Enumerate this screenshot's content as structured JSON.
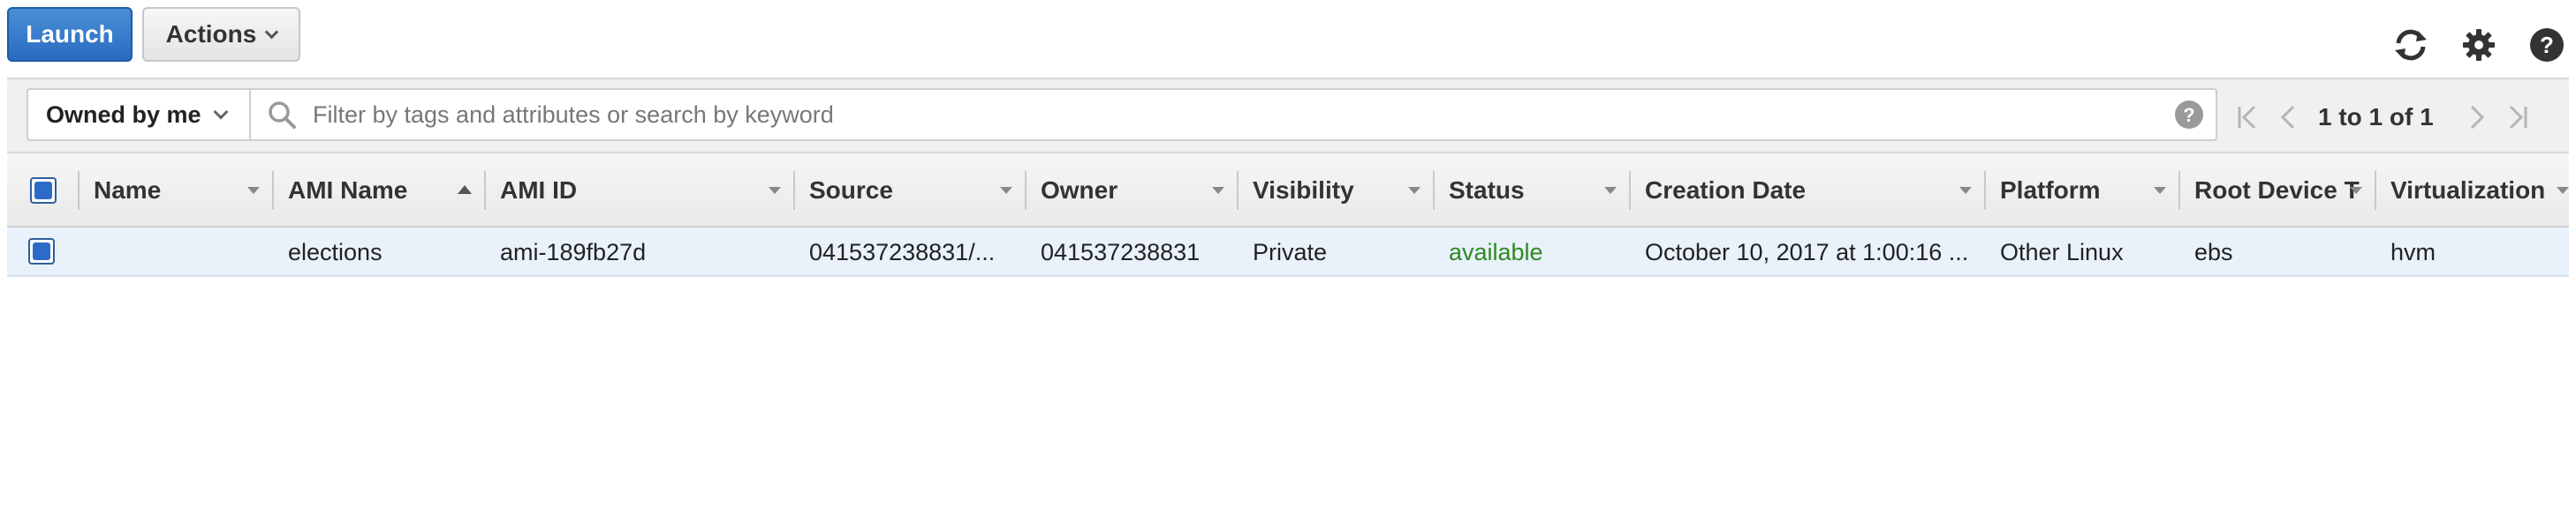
{
  "toolbar": {
    "launch_label": "Launch",
    "actions_label": "Actions"
  },
  "top_icons": [
    "refresh-icon",
    "gear-icon",
    "help-icon"
  ],
  "filter": {
    "owner_filter": "Owned by me",
    "search_placeholder": "Filter by tags and attributes or search by keyword",
    "search_value": ""
  },
  "pagination": {
    "text": "1 to 1 of 1"
  },
  "table": {
    "columns": [
      "Name",
      "AMI Name",
      "AMI ID",
      "Source",
      "Owner",
      "Visibility",
      "Status",
      "Creation Date",
      "Platform",
      "Root Device T",
      "Virtualization"
    ],
    "sorted_column": "AMI Name",
    "rows": [
      {
        "name": "",
        "ami_name": "elections",
        "ami_id": "ami-189fb27d",
        "source": "041537238831/...",
        "owner": "041537238831",
        "visibility": "Private",
        "status": "available",
        "creation_date": "October 10, 2017 at 1:00:16 ...",
        "platform": "Other Linux",
        "root_device": "ebs",
        "virtualization": "hvm",
        "selected": true
      }
    ]
  },
  "colors": {
    "primary": "#2d6bc8",
    "status_available": "#2c8a1f",
    "row_selected_bg": "#e9f1fb"
  }
}
